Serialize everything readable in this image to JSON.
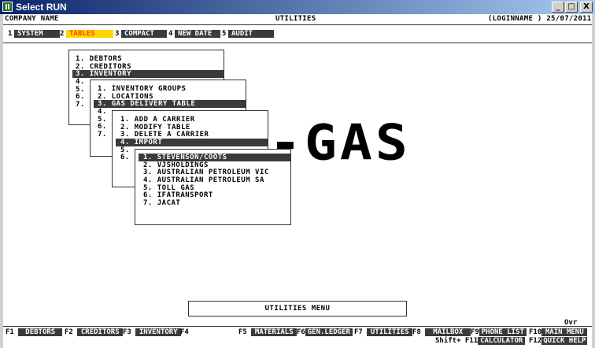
{
  "window": {
    "title": "Select RUN",
    "btn_min": "_",
    "btn_max": "□",
    "btn_close": "X"
  },
  "header": {
    "company": "COMPANY NAME",
    "title": "UTILITIES",
    "user_date": "(LOGINNAME ) 25/07/2011"
  },
  "menubar": [
    {
      "num": "1",
      "label": "SYSTEM"
    },
    {
      "num": "2",
      "label": "TABLES",
      "active": true
    },
    {
      "num": "3",
      "label": "COMPACT"
    },
    {
      "num": "4",
      "label": "NEW DATE"
    },
    {
      "num": "5",
      "label": "AUDIT"
    }
  ],
  "menus": {
    "tables": [
      "1. DEBTORS",
      "2. CREDITORS",
      "3. INVENTORY",
      "4.",
      "5.",
      "6.",
      "7."
    ],
    "inventory": [
      "1. INVENTORY GROUPS",
      "2. LOCATIONS",
      "3. GAS DELIVERY TABLE",
      "4.",
      "5.",
      "6.",
      "7."
    ],
    "gas_delivery": [
      "1. ADD A CARRIER",
      "2. MODIFY TABLE",
      "3. DELETE A CARRIER",
      "4. IMPORT",
      "5.",
      "6."
    ],
    "carriers": [
      "1. STEVENSON/COOTS",
      "2. VJSHOLDINGS",
      "3. AUSTRALIAN PETROLEUM VIC",
      "4. AUSTRALIAN PETROLEUM SA",
      "5. TOLL GAS",
      "6. IFATRANSPORT",
      "7. JACAT"
    ]
  },
  "logo_text": "-GAS",
  "status": "UTILITIES MENU",
  "ovr": "Ovr",
  "fkeys_row1": [
    {
      "key": "F1",
      "label": "DEBTORS"
    },
    {
      "key": "F2",
      "label": "CREDITORS"
    },
    {
      "key": "F3",
      "label": "INVENTORY"
    },
    {
      "key": "F4",
      "label": ""
    },
    {
      "key": "F5",
      "label": "MATERIALS"
    },
    {
      "key": "F6",
      "label": "GEN.LEDGER"
    },
    {
      "key": "F7",
      "label": "UTILITIES"
    },
    {
      "key": "F8",
      "label": "MAILBOX"
    },
    {
      "key": "F9",
      "label": "PHONE LIST"
    },
    {
      "key": "F10",
      "label": "MAIN MENU"
    }
  ],
  "fkeys_row2": [
    {
      "key": "Shift+ F11",
      "label": "CALCULATOR"
    },
    {
      "key": "F12",
      "label": "QUICK HELP"
    }
  ]
}
